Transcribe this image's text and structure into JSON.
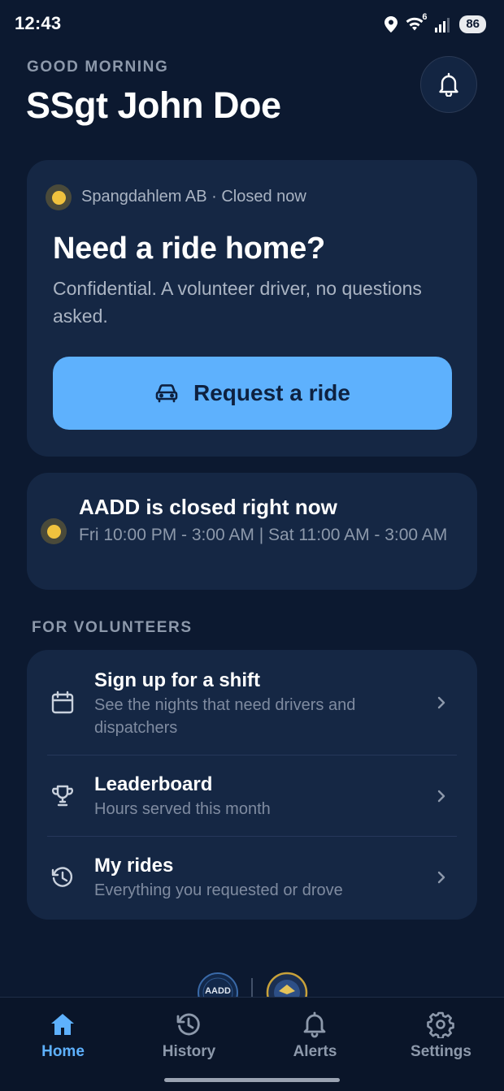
{
  "status_bar": {
    "time": "12:43",
    "battery": "86",
    "wifi_badge": "6"
  },
  "header": {
    "greeting": "GOOD MORNING",
    "name": "SSgt John Doe",
    "bell_icon": "bell-icon"
  },
  "hero": {
    "status": "Spangdahlem AB · Closed now",
    "title": "Need a ride home?",
    "subtitle": "Confidential. A volunteer driver, no questions asked.",
    "button_label": "Request a ride",
    "button_icon": "car-icon",
    "status_color": "#f0c23e",
    "accent_color": "#5eb1fd"
  },
  "closed_notice": {
    "title": "AADD is closed right now",
    "hours": "Fri 10:00 PM - 3:00 AM | Sat 11:00 AM - 3:00 AM"
  },
  "volunteers": {
    "section_label": "FOR VOLUNTEERS",
    "items": [
      {
        "title": "Sign up for a shift",
        "subtitle": "See the nights that need drivers and dispatchers",
        "icon": "calendar-icon"
      },
      {
        "title": "Leaderboard",
        "subtitle": "Hours served this month",
        "icon": "trophy-icon"
      },
      {
        "title": "My rides",
        "subtitle": "Everything you requested or drove",
        "icon": "history-icon"
      }
    ]
  },
  "footer": {
    "logo_text": "AADD"
  },
  "bottom_nav": {
    "items": [
      {
        "label": "Home",
        "icon": "home-icon",
        "active": true
      },
      {
        "label": "History",
        "icon": "history-icon",
        "active": false
      },
      {
        "label": "Alerts",
        "icon": "bell-icon",
        "active": false
      },
      {
        "label": "Settings",
        "icon": "gear-icon",
        "active": false
      }
    ]
  }
}
